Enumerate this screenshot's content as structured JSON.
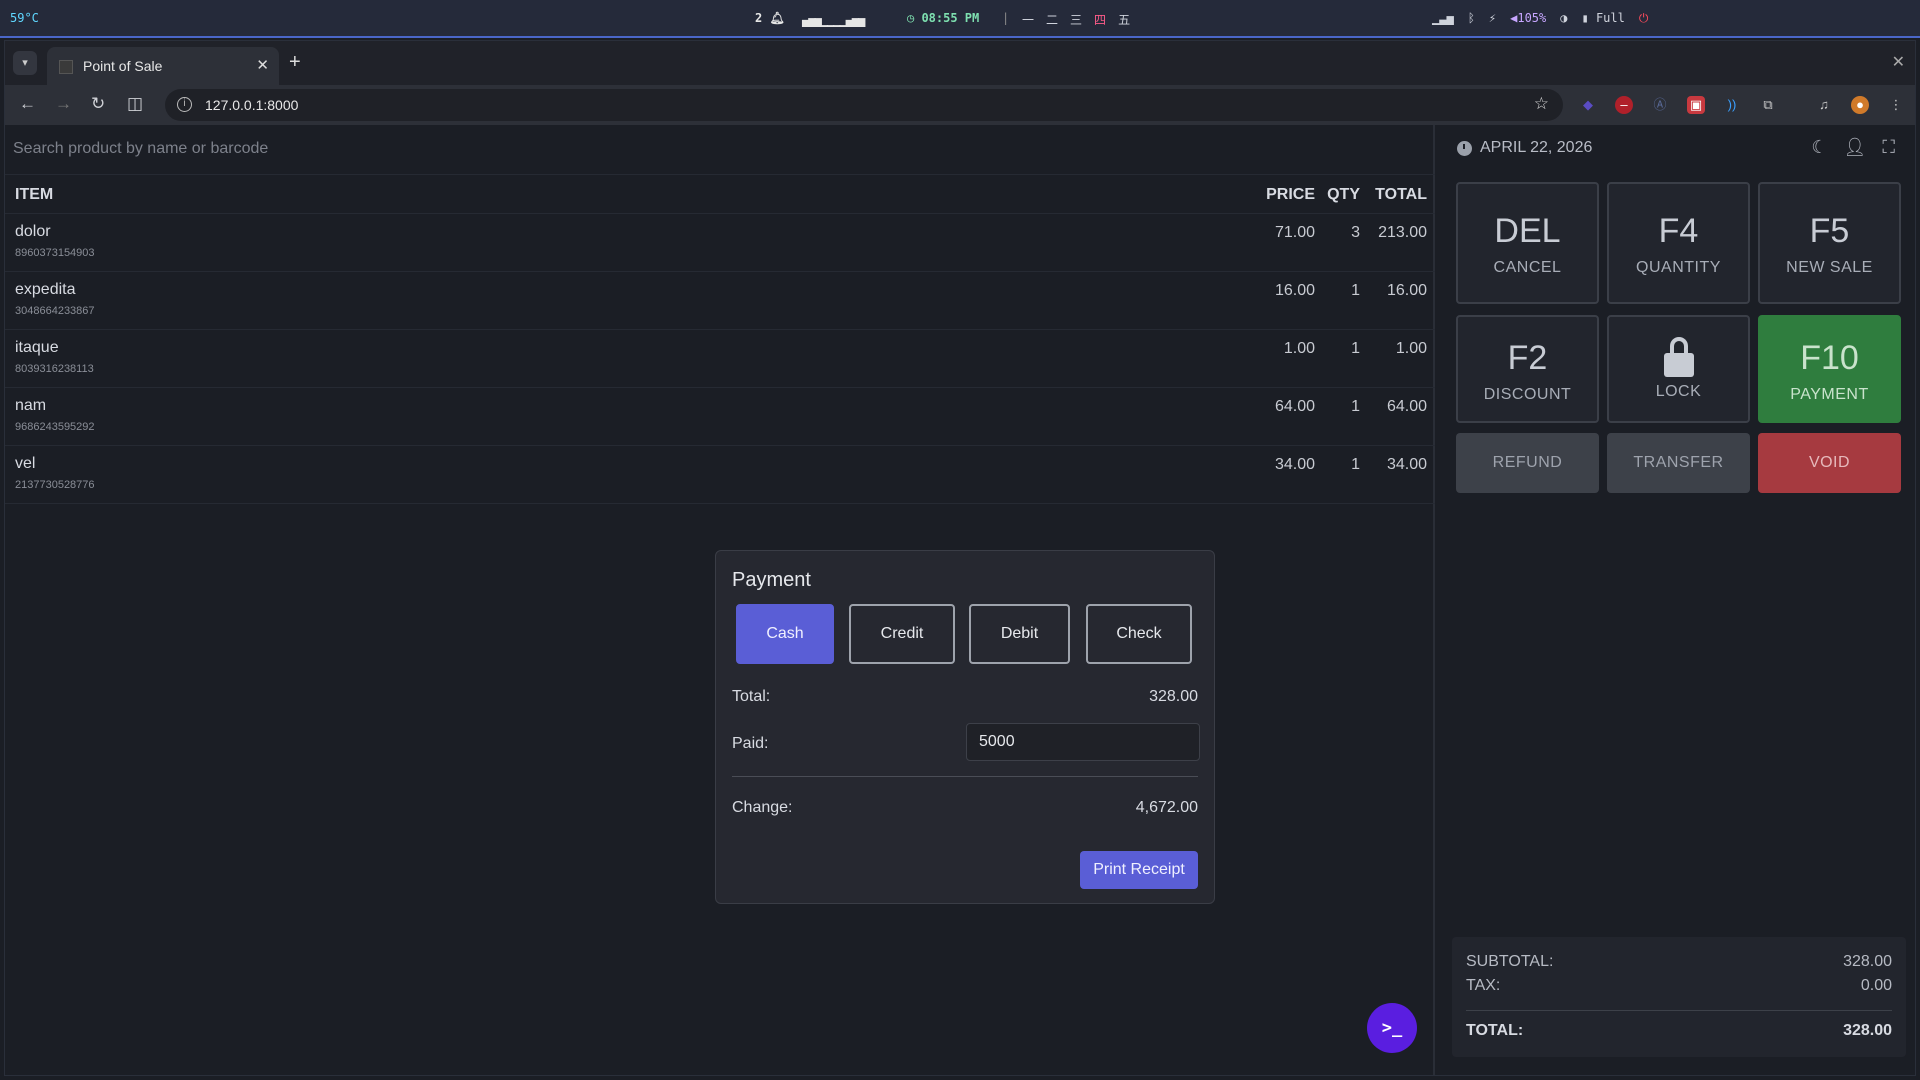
{
  "os": {
    "temperature": "59°C",
    "notifications": "2",
    "clock": "08:55 PM",
    "workspaces": [
      "一",
      "二",
      "三",
      "四",
      "五"
    ],
    "volume": "105%",
    "battery": "Full"
  },
  "browser": {
    "tab_title": "Point of Sale",
    "url": "127.0.0.1:8000"
  },
  "search": {
    "placeholder": "Search product by name or barcode"
  },
  "table": {
    "headers": {
      "item": "ITEM",
      "price": "PRICE",
      "qty": "QTY",
      "total": "TOTAL"
    },
    "rows": [
      {
        "name": "dolor",
        "barcode": "8960373154903",
        "price": "71.00",
        "qty": "3",
        "total": "213.00"
      },
      {
        "name": "expedita",
        "barcode": "3048664233867",
        "price": "16.00",
        "qty": "1",
        "total": "16.00"
      },
      {
        "name": "itaque",
        "barcode": "8039316238113",
        "price": "1.00",
        "qty": "1",
        "total": "1.00"
      },
      {
        "name": "nam",
        "barcode": "9686243595292",
        "price": "64.00",
        "qty": "1",
        "total": "64.00"
      },
      {
        "name": "vel",
        "barcode": "2137730528776",
        "price": "34.00",
        "qty": "1",
        "total": "34.00"
      }
    ]
  },
  "panel": {
    "date": "APRIL 22, 2026",
    "keys": [
      {
        "key": "DEL",
        "label": "CANCEL"
      },
      {
        "key": "F4",
        "label": "QUANTITY"
      },
      {
        "key": "F5",
        "label": "NEW SALE"
      },
      {
        "key": "F2",
        "label": "DISCOUNT"
      },
      {
        "key": "",
        "label": "LOCK"
      },
      {
        "key": "F10",
        "label": "PAYMENT"
      }
    ],
    "actions": {
      "refund": "REFUND",
      "transfer": "TRANSFER",
      "void": "VOID"
    },
    "summary": {
      "subtotal_label": "SUBTOTAL:",
      "subtotal": "328.00",
      "tax_label": "TAX:",
      "tax": "0.00",
      "total_label": "TOTAL:",
      "total": "328.00"
    }
  },
  "modal": {
    "title": "Payment",
    "methods": [
      "Cash",
      "Credit",
      "Debit",
      "Check"
    ],
    "selected_method": "Cash",
    "total_label": "Total:",
    "total": "328.00",
    "paid_label": "Paid:",
    "paid": "5000",
    "change_label": "Change:",
    "change": "4,672.00",
    "print_label": "Print Receipt"
  },
  "fab_label": ">_",
  "colors": {
    "accent": "#5a5ed6",
    "payment_green": "#2f7d3e",
    "void_red": "#a63a40",
    "fab": "#5a1ee0"
  }
}
